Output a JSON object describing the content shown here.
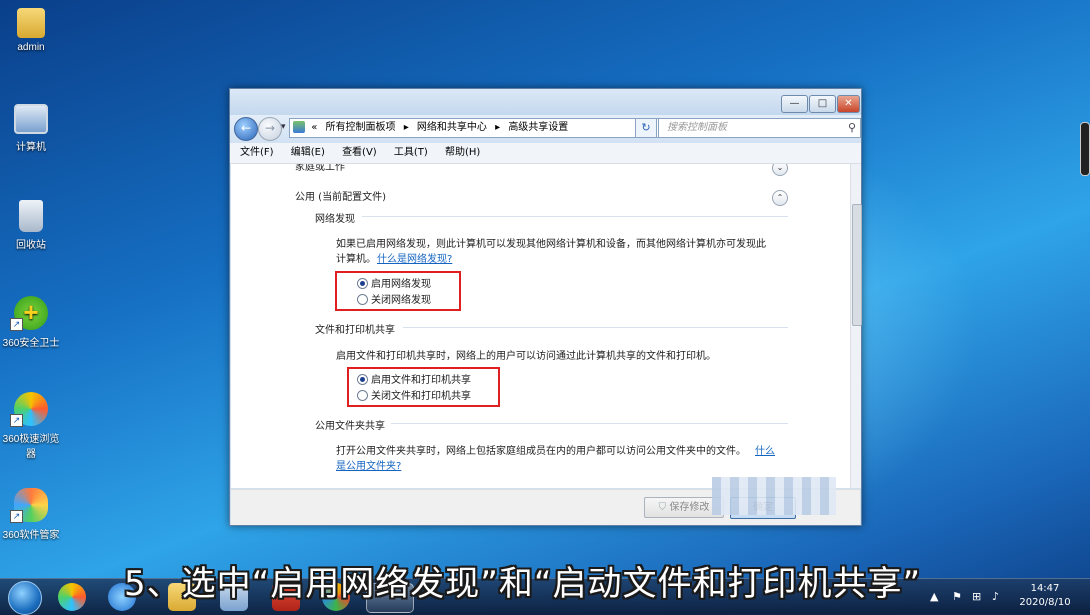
{
  "desktop": {
    "icons": [
      {
        "label": "admin",
        "icon": "folder-icon"
      },
      {
        "label": "计算机",
        "icon": "computer-icon"
      },
      {
        "label": "回收站",
        "icon": "recycle-bin-icon"
      },
      {
        "label": "360安全卫士",
        "icon": "360-security-icon"
      },
      {
        "label": "360极速浏览器",
        "icon": "360-browser-icon"
      },
      {
        "label": "360软件管家",
        "icon": "360-software-manager-icon"
      }
    ]
  },
  "window": {
    "controls": {
      "minimize": "—",
      "maximize": "□",
      "close": "✕"
    },
    "nav": {
      "back": "←",
      "forward": "→",
      "dropdown": "▾",
      "refresh": "↻"
    },
    "breadcrumb": [
      "«",
      "所有控制面板项",
      "▸",
      "网络和共享中心",
      "▸",
      "高级共享设置"
    ],
    "search_placeholder": "搜索控制面板",
    "menu": [
      "文件(F)",
      "编辑(E)",
      "查看(V)",
      "工具(T)",
      "帮助(H)"
    ],
    "sections": {
      "home_work": "家庭或工作",
      "public": "公用 (当前配置文件)"
    },
    "network_discovery": {
      "heading": "网络发现",
      "desc1": "如果已启用网络发现，则此计算机可以发现其他网络计算机和设备，而其他网络计算机亦可发现此",
      "desc2": "计算机。",
      "link": "什么是网络发现?",
      "options": [
        "启用网络发现",
        "关闭网络发现"
      ],
      "selected": 0
    },
    "file_printer_sharing": {
      "heading": "文件和打印机共享",
      "desc": "启用文件和打印机共享时，网络上的用户可以访问通过此计算机共享的文件和打印机。",
      "options": [
        "启用文件和打印机共享",
        "关闭文件和打印机共享"
      ],
      "selected": 0
    },
    "public_folder_sharing": {
      "heading": "公用文件夹共享",
      "desc1": "打开公用文件夹共享时，网络上包括家庭组成员在内的用户都可以访问公用文件夹中的文件。",
      "link1": "什么",
      "link2": "是公用文件夹?"
    },
    "footer": {
      "save": "保存修改",
      "ok": "确定"
    }
  },
  "taskbar": {
    "time": "14:47",
    "date": "2020/8/10"
  },
  "caption": "5、选中“启用网络发现”和“启动文件和打印机共享”",
  "colors": {
    "highlight_box": "#e02020",
    "link": "#1565c0",
    "accent": "#1d6fc0"
  }
}
